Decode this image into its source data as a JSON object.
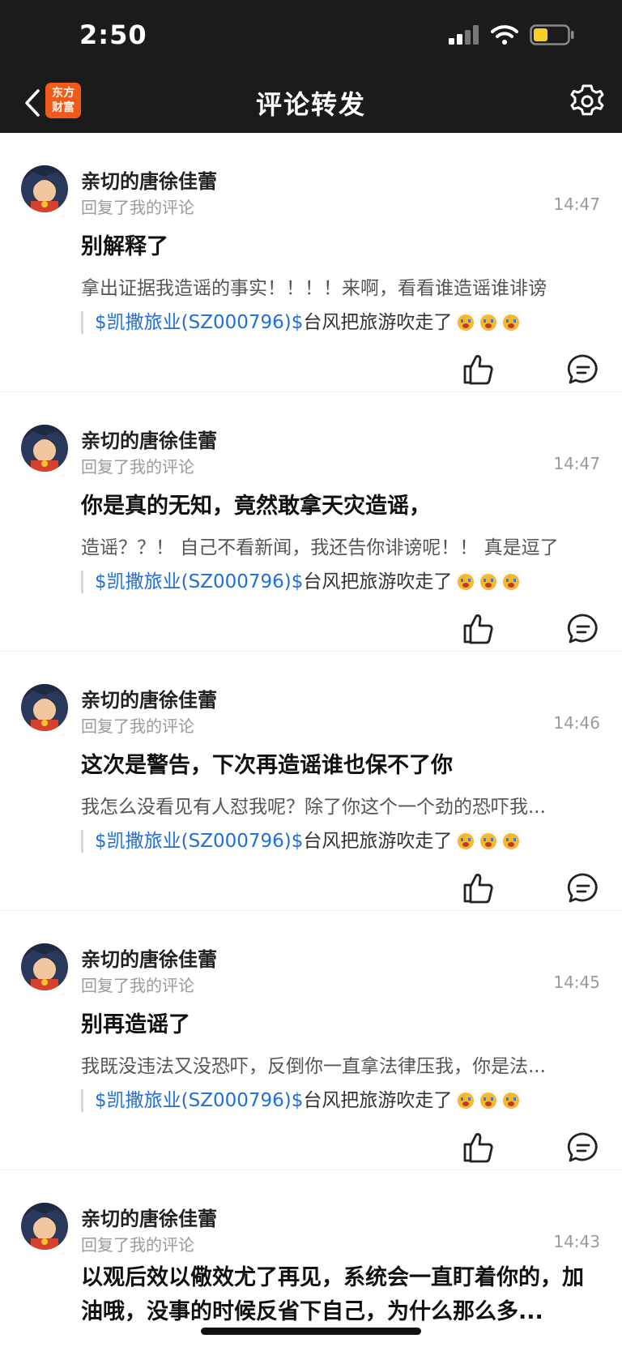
{
  "status": {
    "time": "2:50"
  },
  "nav": {
    "title": "评论转发",
    "logo_line1": "东方",
    "logo_line2": "财富",
    "brand_color": "#f05a1a"
  },
  "comments": [
    {
      "user": "亲切的唐徐佳蕾",
      "action": "回复了我的评论",
      "time": "14:47",
      "reply": "别解释了",
      "quote": "拿出证据我造谣的事实！！！！来啊，看看谁造谣谁诽谤",
      "ref_stock": "$凯撒旅业(SZ000796)$",
      "ref_text": "台风把旅游吹走了"
    },
    {
      "user": "亲切的唐徐佳蕾",
      "action": "回复了我的评论",
      "time": "14:47",
      "reply": "你是真的无知，竟然敢拿天灾造谣，",
      "quote": "造谣？？！ 自己不看新闻，我还告你诽谤呢！！ 真是逗了",
      "ref_stock": "$凯撒旅业(SZ000796)$",
      "ref_text": "台风把旅游吹走了"
    },
    {
      "user": "亲切的唐徐佳蕾",
      "action": "回复了我的评论",
      "time": "14:46",
      "reply": "这次是警告，下次再造谣谁也保不了你",
      "quote": "我怎么没看见有人怼我呢？除了你这个一个劲的恐吓我...",
      "ref_stock": "$凯撒旅业(SZ000796)$",
      "ref_text": "台风把旅游吹走了"
    },
    {
      "user": "亲切的唐徐佳蕾",
      "action": "回复了我的评论",
      "time": "14:45",
      "reply": "别再造谣了",
      "quote": "我既没违法又没恐吓，反倒你一直拿法律压我，你是法...",
      "ref_stock": "$凯撒旅业(SZ000796)$",
      "ref_text": "台风把旅游吹走了"
    },
    {
      "user": "亲切的唐徐佳蕾",
      "action": "回复了我的评论",
      "time": "14:43",
      "reply": "以观后效以儆效尤了再见，系统会一直盯着你的，加油哦，没事的时候反省下自己，为什么那么多..."
    }
  ]
}
